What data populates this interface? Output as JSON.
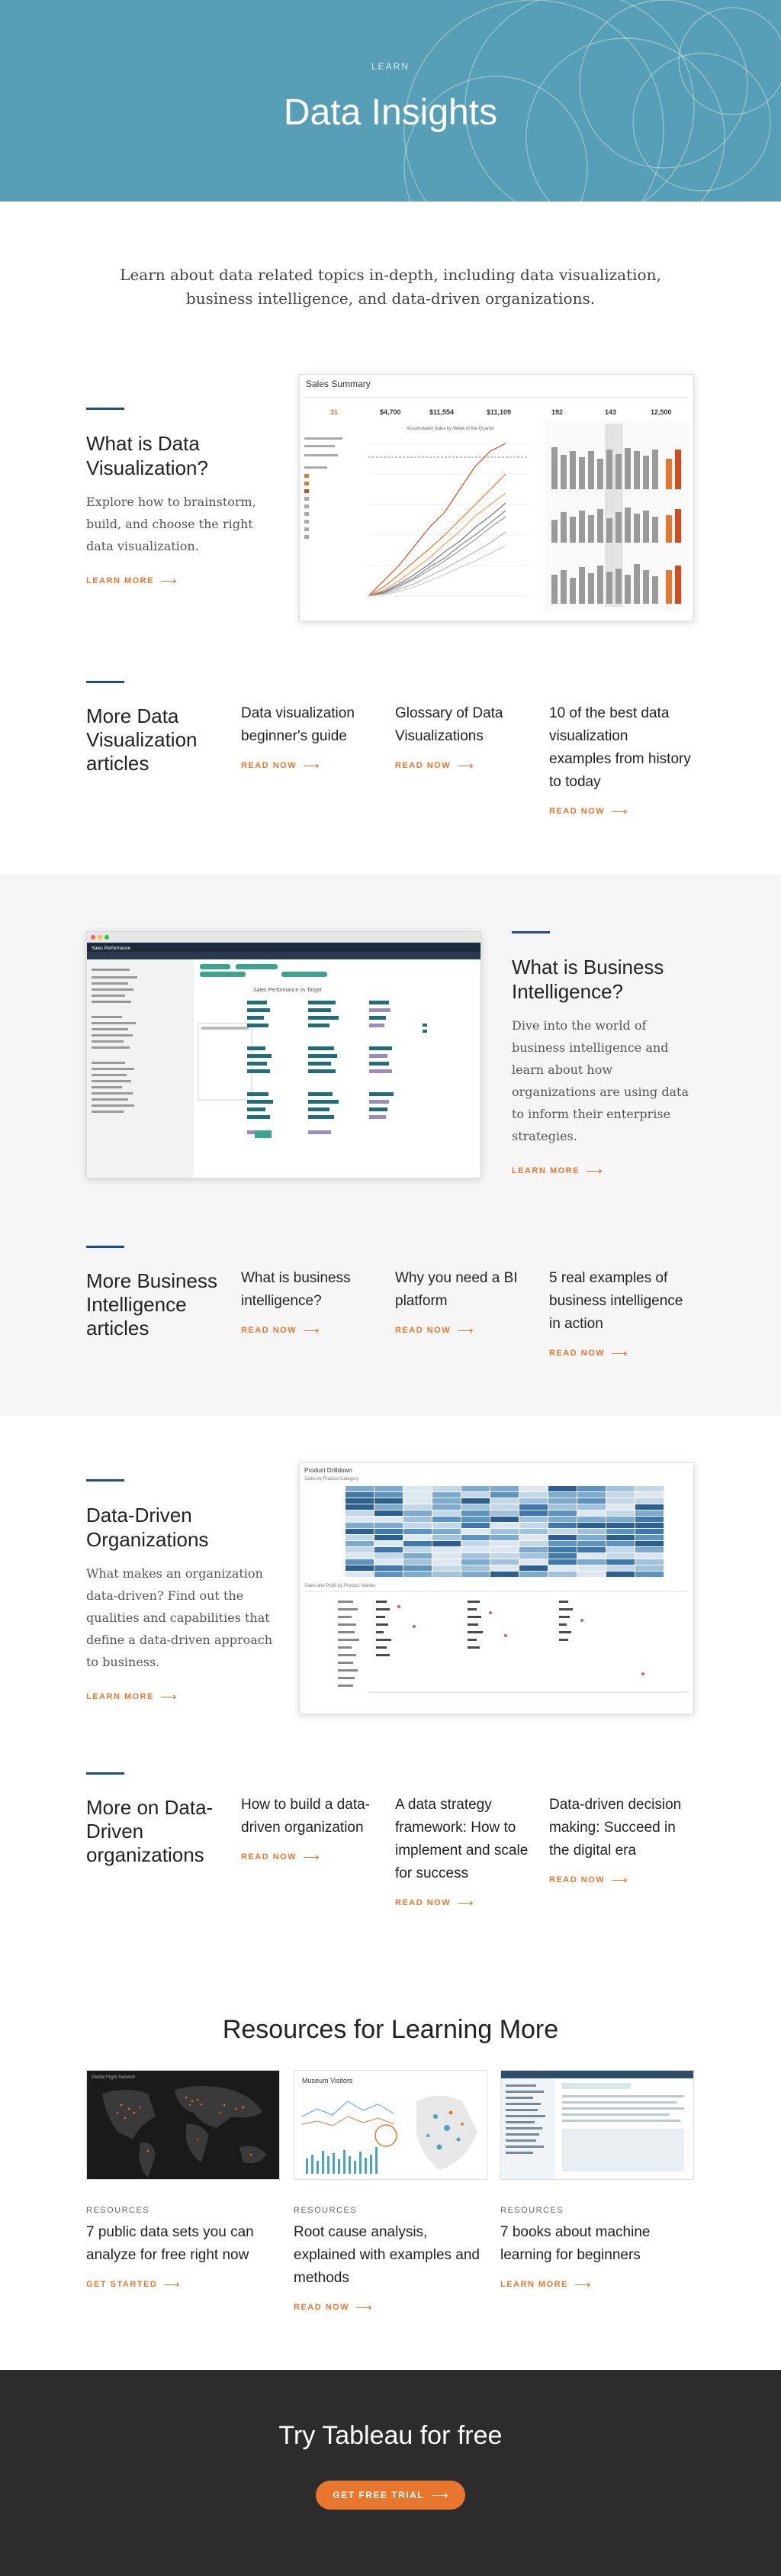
{
  "hero": {
    "eyebrow": "LEARN",
    "title": "Data Insights"
  },
  "intro": "Learn about data related topics in-depth, including data visualization, business intelligence, and data-driven organizations.",
  "dataviz": {
    "title": "What is Data Visualization?",
    "text": "Explore how to brainstorm, build, and choose the right data visualization.",
    "cta": "LEARN MORE",
    "screenshot": {
      "title": "Sales Summary",
      "chart_title": "Accumulated Sales by Week of the Quarter",
      "kpi_values": [
        "31",
        "$4,700",
        "$11,554",
        "$11,109",
        "192",
        "143",
        "12,500"
      ]
    },
    "more_heading": "More Data Visualization articles",
    "articles": [
      {
        "title": "Data visualization beginner's guide",
        "cta": "READ NOW"
      },
      {
        "title": "Glossary of Data Visualizations",
        "cta": "READ NOW"
      },
      {
        "title": "10 of the best data visualization examples from history to today",
        "cta": "READ NOW"
      }
    ]
  },
  "bi": {
    "title": "What is Business Intelligence?",
    "text": "Dive into the world of business intelligence and learn about how organizations are using data to inform their enterprise strategies.",
    "cta": "LEARN MORE",
    "screenshot": {
      "window_title": "Sales Performance",
      "chart_title": "Sales Performance vs Target"
    },
    "more_heading": "More Business Intelligence articles",
    "articles": [
      {
        "title": "What is business intelligence?",
        "cta": "READ NOW"
      },
      {
        "title": "Why you need a BI platform",
        "cta": "READ NOW"
      },
      {
        "title": "5 real examples of business intelligence in action",
        "cta": "READ NOW"
      }
    ]
  },
  "ddo": {
    "title": "Data-Driven Organizations",
    "text": "What makes an organization data-driven? Find out the qualities and capabilities that define a data-driven approach to business.",
    "cta": "LEARN MORE",
    "screenshot": {
      "title": "Product Drilldown",
      "subtitle": "Sales by Product Category",
      "lower_title": "Sales and Profit by Product Names"
    },
    "more_heading": "More on Data-Driven organizations",
    "articles": [
      {
        "title": "How to build a data-driven organization",
        "cta": "READ NOW"
      },
      {
        "title": "A data strategy framework: How to implement and scale for success",
        "cta": "READ NOW"
      },
      {
        "title": "Data-driven decision making: Succeed in the digital era",
        "cta": "READ NOW"
      }
    ]
  },
  "resources": {
    "heading": "Resources for Learning More",
    "cards": [
      {
        "kicker": "RESOURCES",
        "title": "7 public data sets you can analyze for free right now",
        "cta": "GET STARTED",
        "image_label": "Global Flight Network"
      },
      {
        "kicker": "RESOURCES",
        "title": "Root cause analysis, explained with examples and methods",
        "cta": "READ NOW",
        "image_label": "Museum Visitors"
      },
      {
        "kicker": "RESOURCES",
        "title": "7 books about machine learning for beginners",
        "cta": "LEARN MORE",
        "image_label": ""
      }
    ]
  },
  "footer": {
    "title": "Try Tableau for free",
    "cta": "GET FREE TRIAL"
  },
  "colors": {
    "hero_bg": "#569fb6",
    "accent_orange": "#e8762d",
    "rule_blue": "#1f4e8c",
    "footer_bg": "#2c2c2c",
    "gray_section": "#f6f6f6"
  },
  "icons": {
    "cta_arrow": "arrow-right-icon"
  }
}
